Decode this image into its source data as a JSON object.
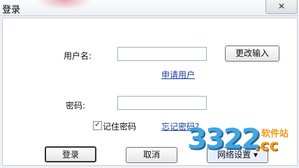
{
  "window": {
    "title": "登录",
    "close_glyph": "✕"
  },
  "form": {
    "username_label": "用户名:",
    "username_value": "",
    "change_input_label": "更改输入",
    "register_link": "申请用户",
    "password_label": "密码:",
    "password_value": "",
    "remember_label": "记住密码",
    "remember_checked": true,
    "forgot_link": "忘记密码?"
  },
  "buttons": {
    "login": "登录",
    "cancel": "取消",
    "network_settings": "网络设置"
  },
  "watermark": {
    "main": "3322",
    "domain": ".cc",
    "site": "软件站"
  }
}
